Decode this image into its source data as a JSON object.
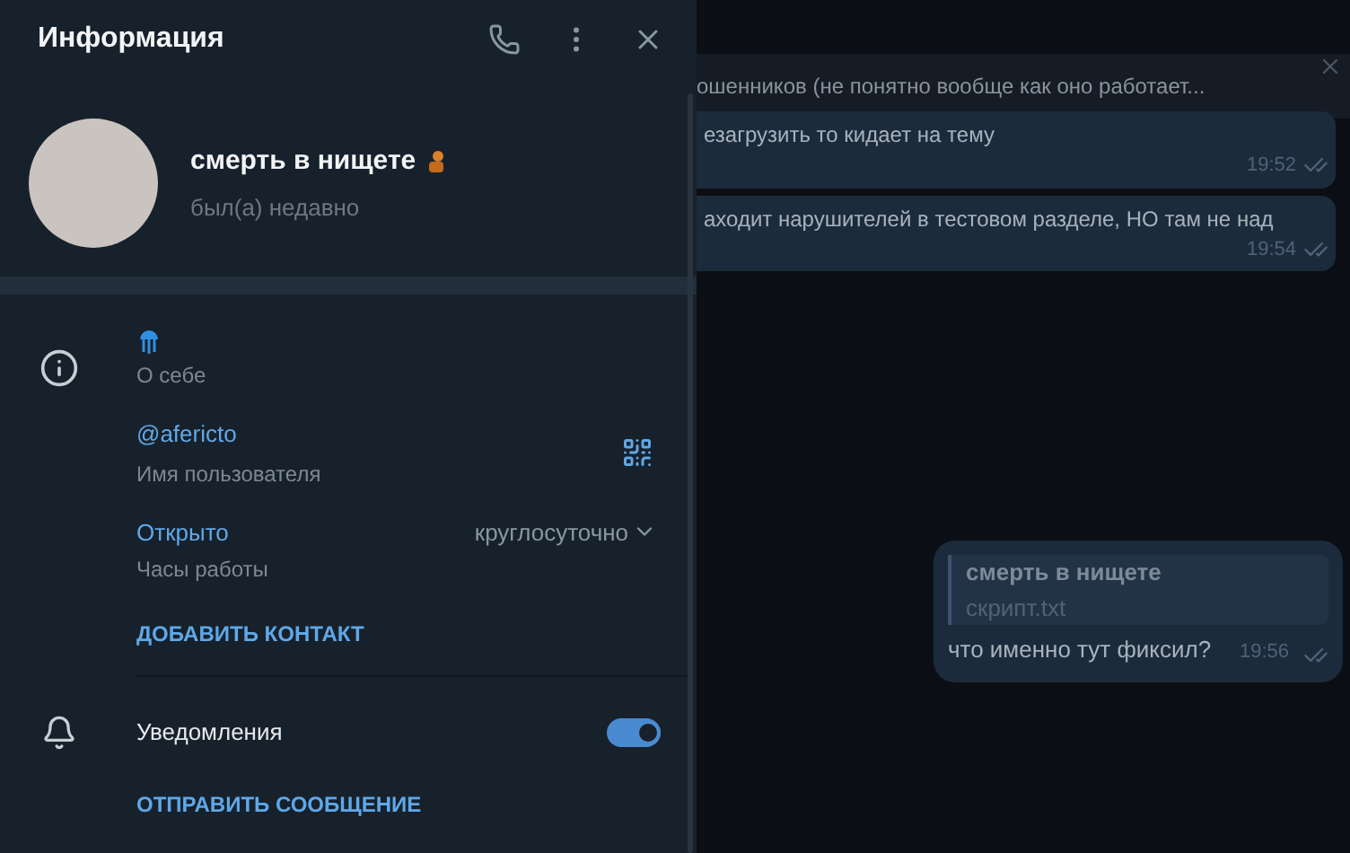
{
  "panel": {
    "title": "Информация",
    "profile": {
      "name": "смерть в нищете",
      "status": "был(а) недавно"
    },
    "info": {
      "bio_label": "О себе",
      "username": "@afericto",
      "username_label": "Имя пользователя",
      "hours_value": "Открыто",
      "hours_detail": "круглосуточно",
      "hours_label": "Часы работы",
      "add_contact": "ДОБАВИТЬ КОНТАКТ"
    },
    "notifications": {
      "label": "Уведомления",
      "on": true
    },
    "send_message": "ОТПРАВИТЬ СООБЩЕНИЕ"
  },
  "chat": {
    "pinned": "ошенников (не понятно вообще как оно работает...",
    "messages": [
      {
        "kind": "text",
        "text": "езагрузить то кидает на тему",
        "time": "19:52"
      },
      {
        "kind": "text",
        "text": "аходит нарушителей в тестовом разделе, НО там не над",
        "time": "19:54"
      },
      {
        "kind": "reply",
        "reply_name": "смерть в нищете",
        "reply_file": "скрипт.txt",
        "text": "что именно тут фиксил?",
        "time": "19:56"
      }
    ]
  }
}
